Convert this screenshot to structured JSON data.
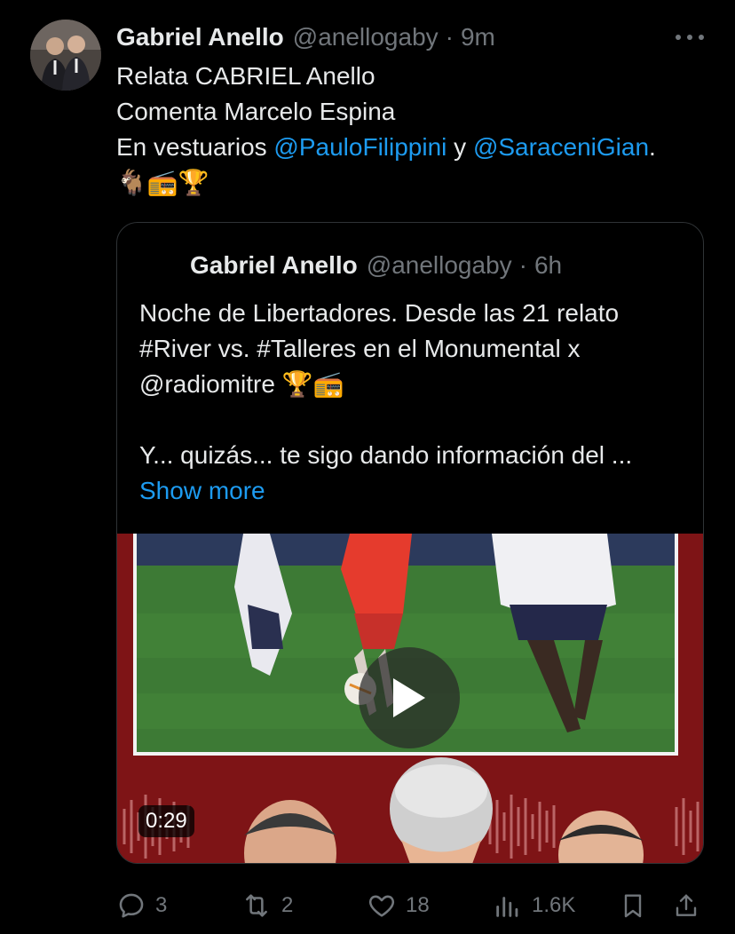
{
  "tweet": {
    "author_name": "Gabriel Anello",
    "handle": "@anellogaby",
    "separator": "·",
    "time": "9m",
    "line1": "Relata CABRIEL Anello",
    "line2": "Comenta Marcelo Espina",
    "line3_prefix": "En vestuarios ",
    "mention1": "@PauloFilippini",
    "line3_mid": " y ",
    "mention2": "@SaraceniGian",
    "line3_suffix": ".",
    "emoji_line": "🐐📻🏆"
  },
  "quote": {
    "author_name": "Gabriel Anello",
    "handle": "@anellogaby",
    "separator": "·",
    "time": "6h",
    "line1": "Noche de Libertadores. Desde las 21 relato",
    "line2": "#River vs. #Talleres en el Monumental x",
    "line3": "@radiomitre 🏆📻",
    "line4": "Y... quizás... te sigo dando información del ...",
    "show_more": "Show more",
    "video_duration": "0:29"
  },
  "actions": {
    "replies": "3",
    "reposts": "2",
    "likes": "18",
    "views": "1.6K"
  },
  "colors": {
    "background": "#000000",
    "text": "#e7e9ea",
    "secondary": "#71767b",
    "link": "#1d9bf0",
    "media_red": "#7e1416"
  }
}
